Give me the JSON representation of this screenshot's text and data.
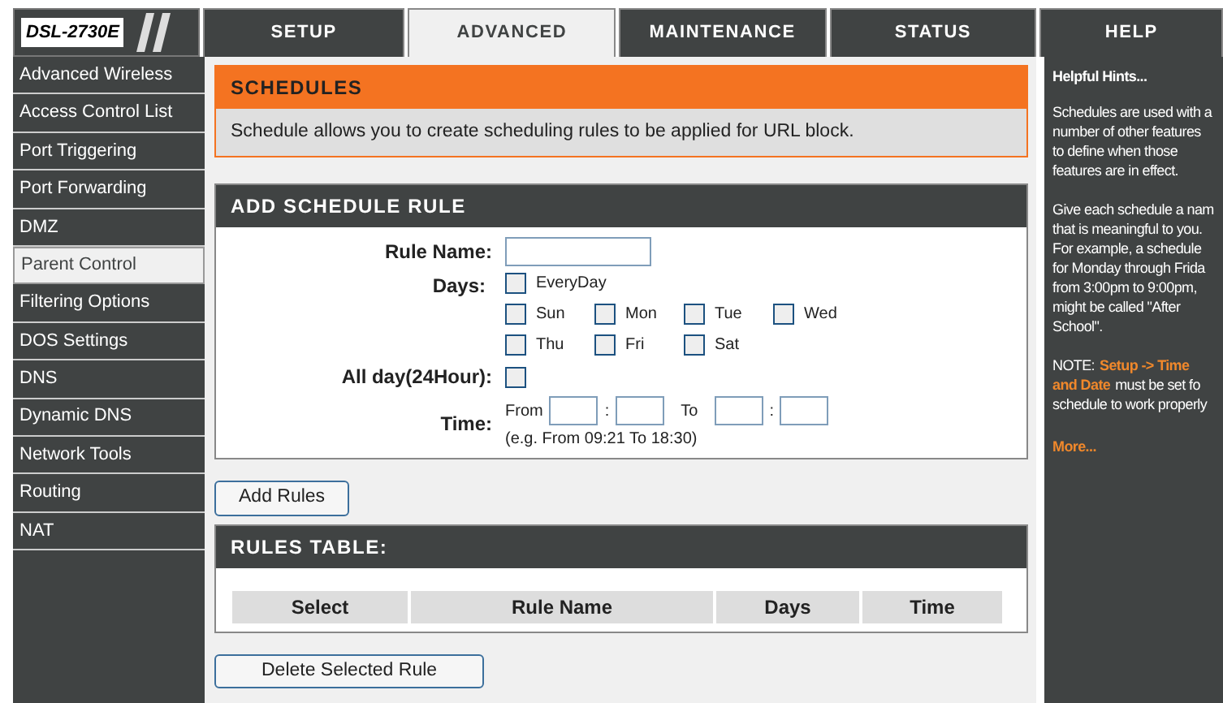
{
  "logo": {
    "model": "DSL-2730E"
  },
  "tabs": [
    {
      "label": "SETUP",
      "selected": false
    },
    {
      "label": "ADVANCED",
      "selected": true
    },
    {
      "label": "MAINTENANCE",
      "selected": false
    },
    {
      "label": "STATUS",
      "selected": false
    },
    {
      "label": "HELP",
      "selected": false
    }
  ],
  "sidebar": {
    "items": [
      {
        "label": "Advanced Wireless",
        "selected": false
      },
      {
        "label": "Access Control List",
        "selected": false
      },
      {
        "label": "Port Triggering",
        "selected": false
      },
      {
        "label": "Port Forwarding",
        "selected": false
      },
      {
        "label": "DMZ",
        "selected": false
      },
      {
        "label": "Parent Control",
        "selected": true
      },
      {
        "label": "Filtering Options",
        "selected": false
      },
      {
        "label": "DOS Settings",
        "selected": false
      },
      {
        "label": "DNS",
        "selected": false
      },
      {
        "label": "Dynamic DNS",
        "selected": false
      },
      {
        "label": "Network Tools",
        "selected": false
      },
      {
        "label": "Routing",
        "selected": false
      },
      {
        "label": "NAT",
        "selected": false
      }
    ]
  },
  "schedules": {
    "title": "SCHEDULES",
    "description": "Schedule allows you to create scheduling rules to be applied for URL block."
  },
  "add_rule": {
    "title": "ADD SCHEDULE RULE",
    "rule_name_label": "Rule Name:",
    "days_label": "Days:",
    "days": [
      [
        {
          "label": "EveryDay",
          "checked": false
        }
      ],
      [
        {
          "label": "Sun",
          "checked": false
        },
        {
          "label": "Mon",
          "checked": false
        },
        {
          "label": "Tue",
          "checked": false
        },
        {
          "label": "Wed",
          "checked": false
        }
      ],
      [
        {
          "label": "Thu",
          "checked": false
        },
        {
          "label": "Fri",
          "checked": false
        },
        {
          "label": "Sat",
          "checked": false
        }
      ]
    ],
    "all_day_label": "All day(24Hour):",
    "all_day_checked": false,
    "time_label": "Time:",
    "from_label": "From",
    "separator_1": ":",
    "to_label": "To",
    "separator_2": ":",
    "time_hint": "(e.g. From 09:21 To 18:30)"
  },
  "add_button": "Add Rules",
  "rules_table": {
    "title": "RULES TABLE:",
    "columns": [
      "Select",
      "Rule Name",
      "Days",
      "Time"
    ]
  },
  "delete_button": "Delete Selected Rule",
  "help": {
    "title": "Helpful Hints...",
    "paragraphs": [
      [
        [
          {
            "text": "Schedules are used with a"
          }
        ],
        [
          {
            "text": "number of other features"
          }
        ],
        [
          {
            "text": "to define when those"
          }
        ],
        [
          {
            "text": "features are in effect."
          }
        ]
      ],
      [
        [
          {
            "text": "Give each schedule a nam"
          }
        ],
        [
          {
            "text": "that is meaningful to you."
          }
        ],
        [
          {
            "text": "For example, a schedule"
          }
        ],
        [
          {
            "text": "for Monday through Frida"
          }
        ],
        [
          {
            "text": "from 3:00pm to 9:00pm,"
          }
        ],
        [
          {
            "text": "might be called \"After"
          }
        ],
        [
          {
            "text": "School\"."
          }
        ]
      ],
      [
        [
          {
            "text": "NOTE:",
            "kind": "plain"
          },
          {
            "text": "Setup -> Time",
            "kind": "link"
          }
        ],
        [
          {
            "text": "and Date",
            "kind": "link"
          },
          {
            "text": "must be set fo",
            "kind": "plain"
          }
        ],
        [
          {
            "text": "schedule to work properly",
            "kind": "plain"
          }
        ]
      ]
    ],
    "more": "More..."
  }
}
